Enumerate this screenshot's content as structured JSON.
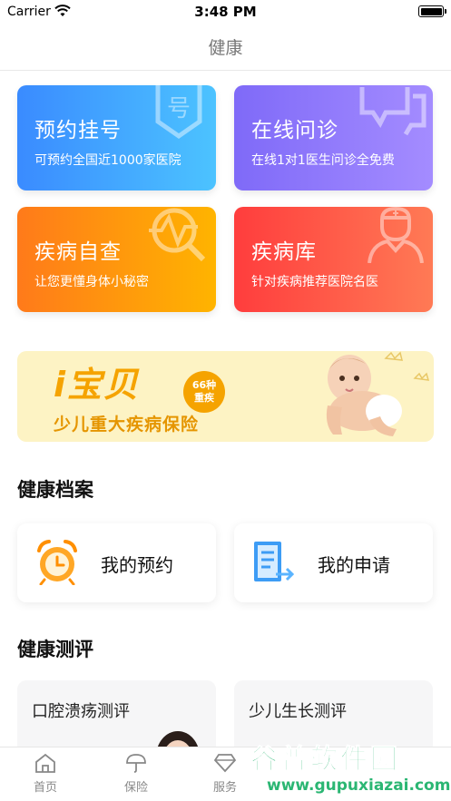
{
  "status_bar": {
    "carrier": "Carrier",
    "time": "3:48 PM"
  },
  "nav": {
    "title": "健康"
  },
  "services": [
    {
      "title": "预约挂号",
      "subtitle": "可预约全国近1000家医院",
      "icon": "hospital-number-icon"
    },
    {
      "title": "在线问诊",
      "subtitle": "在线1对1医生问诊全免费",
      "icon": "chat-bubbles-icon"
    },
    {
      "title": "疾病自查",
      "subtitle": "让您更懂身体小秘密",
      "icon": "pulse-search-icon"
    },
    {
      "title": "疾病库",
      "subtitle": "针对疾病推荐医院名医",
      "icon": "doctor-icon"
    }
  ],
  "banner": {
    "brand": "i宝贝",
    "badge_line1": "66种",
    "badge_line2": "重疾",
    "subtitle": "少儿重大疾病保险"
  },
  "records": {
    "heading": "健康档案",
    "items": [
      {
        "label": "我的预约",
        "icon": "alarm-clock-icon"
      },
      {
        "label": "我的申请",
        "icon": "document-export-icon"
      }
    ]
  },
  "tests": {
    "heading": "健康测评",
    "items": [
      {
        "label": "口腔溃疡测评"
      },
      {
        "label": "少儿生长测评"
      }
    ]
  },
  "tabbar": {
    "items": [
      {
        "label": "首页",
        "icon": "home-icon"
      },
      {
        "label": "保险",
        "icon": "umbrella-icon"
      },
      {
        "label": "服务",
        "icon": "diamond-icon"
      }
    ]
  },
  "watermark": {
    "name": "谷普软件园",
    "url": "www.gupuxiazai.com"
  },
  "colors": {
    "blue": "#3a8bff",
    "purple": "#8f7af9",
    "orange": "#ff9a10",
    "red": "#ff4a45",
    "banner_bg": "#fdf3c4"
  }
}
